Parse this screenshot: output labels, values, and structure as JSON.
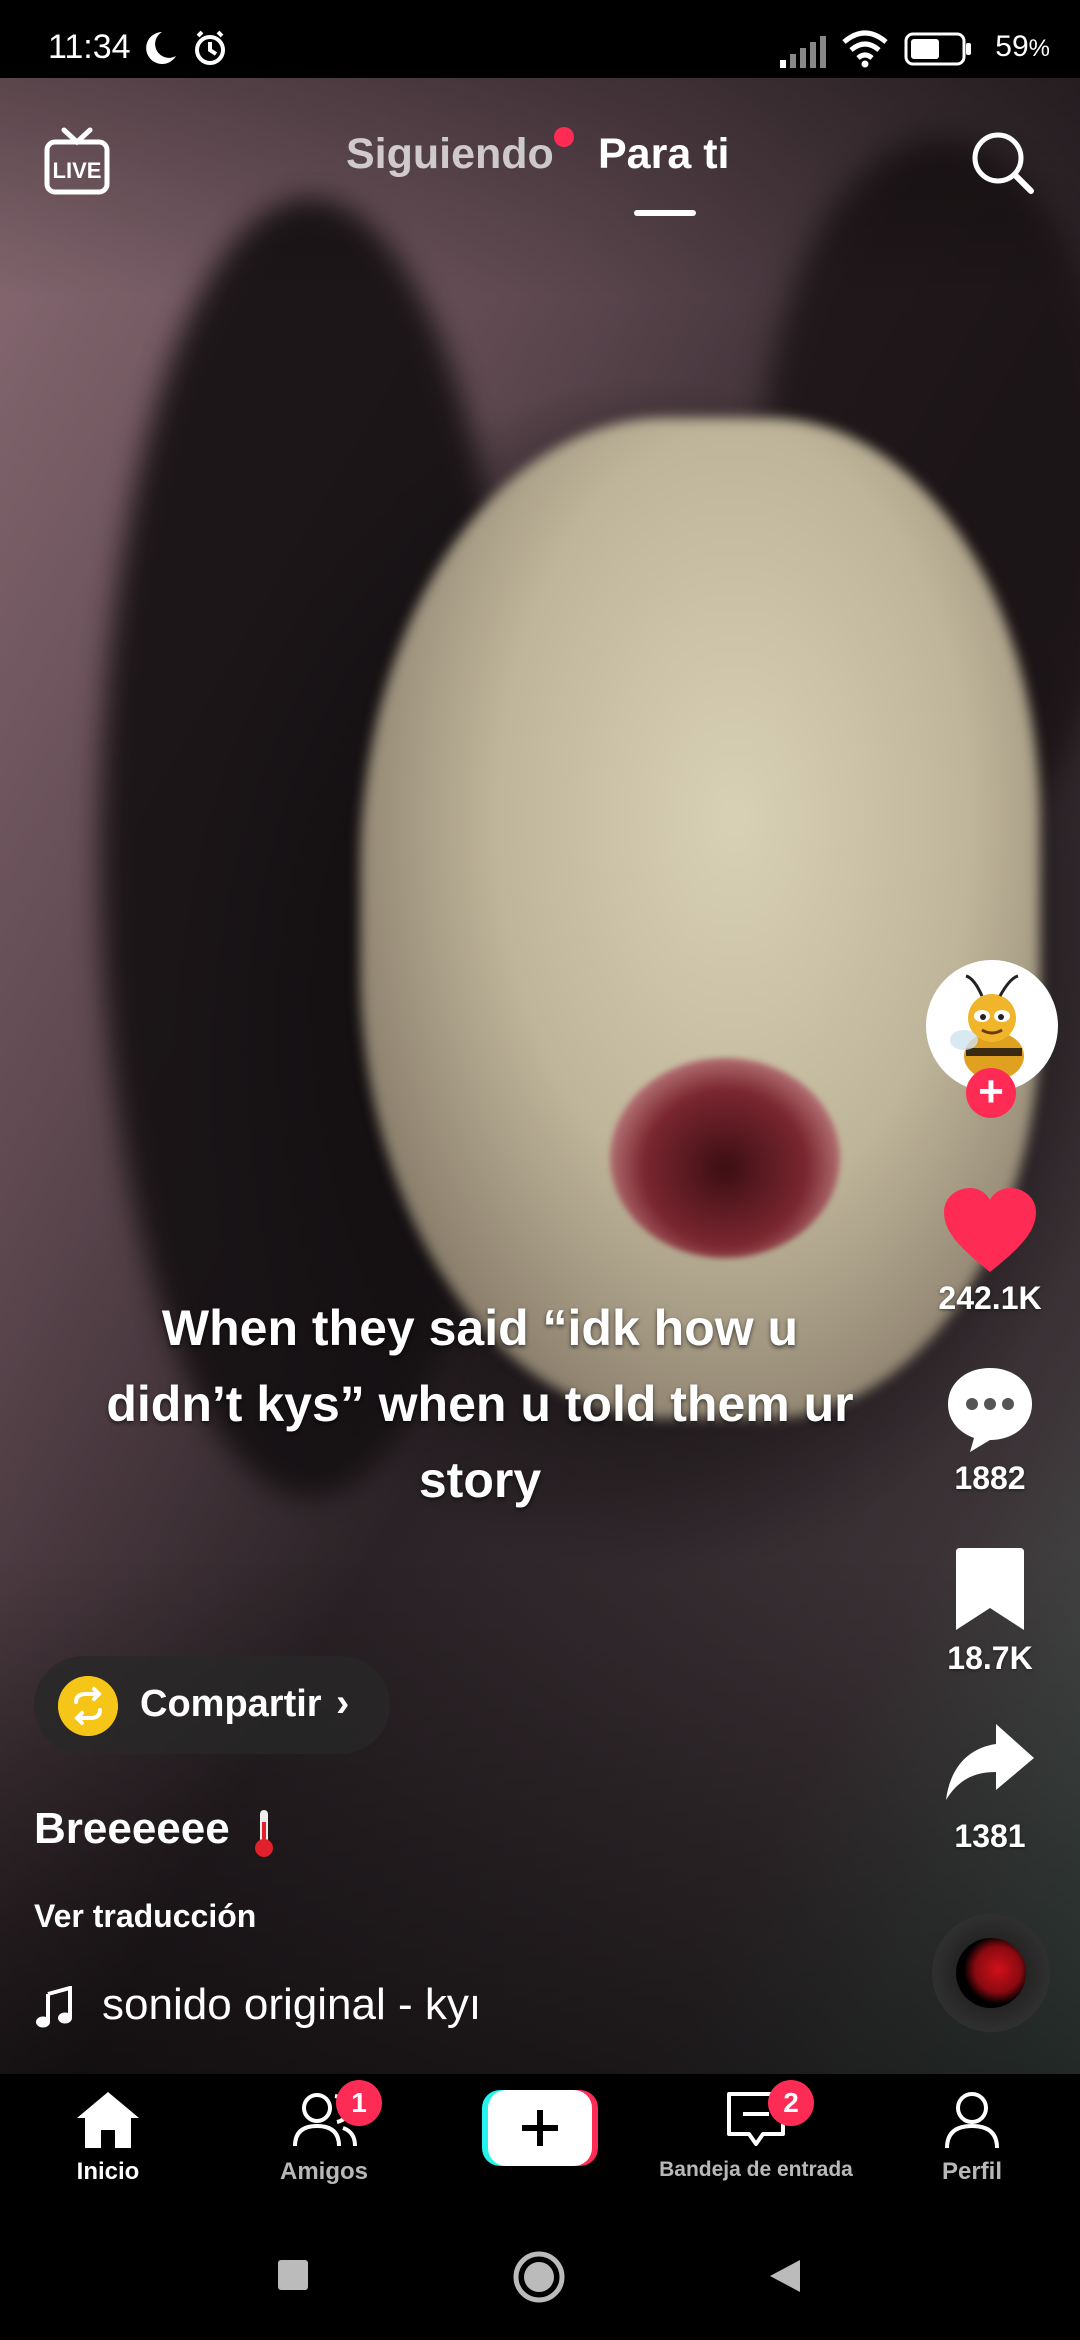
{
  "status_bar": {
    "time": "11:34",
    "battery_percent": "59",
    "battery_suffix": "%"
  },
  "top_nav": {
    "live_icon": "live-tv-icon",
    "tab_following": "Siguiendo",
    "tab_for_you": "Para ti",
    "active_tab": "Para ti",
    "search_icon": "search-icon"
  },
  "video": {
    "caption": "When they said “idk how u didn’t kys” when u told them ur story"
  },
  "actions": {
    "avatar_icon": "bee-avatar",
    "likes": "242.1K",
    "comments": "1882",
    "saves": "18.7K",
    "shares": "1381"
  },
  "share_pill": {
    "label": "Compartir",
    "chevron": "›"
  },
  "post": {
    "username": "Breeeeee",
    "translate": "Ver traducción",
    "sound": "sonido original - kyı"
  },
  "bottom_nav": {
    "home": "Inicio",
    "friends": "Amigos",
    "friends_badge": "1",
    "inbox": "Bandeja de entrada",
    "inbox_badge": "2",
    "profile": "Perfil"
  },
  "colors": {
    "accent": "#fe2c55",
    "share_yellow": "#f5c518"
  }
}
